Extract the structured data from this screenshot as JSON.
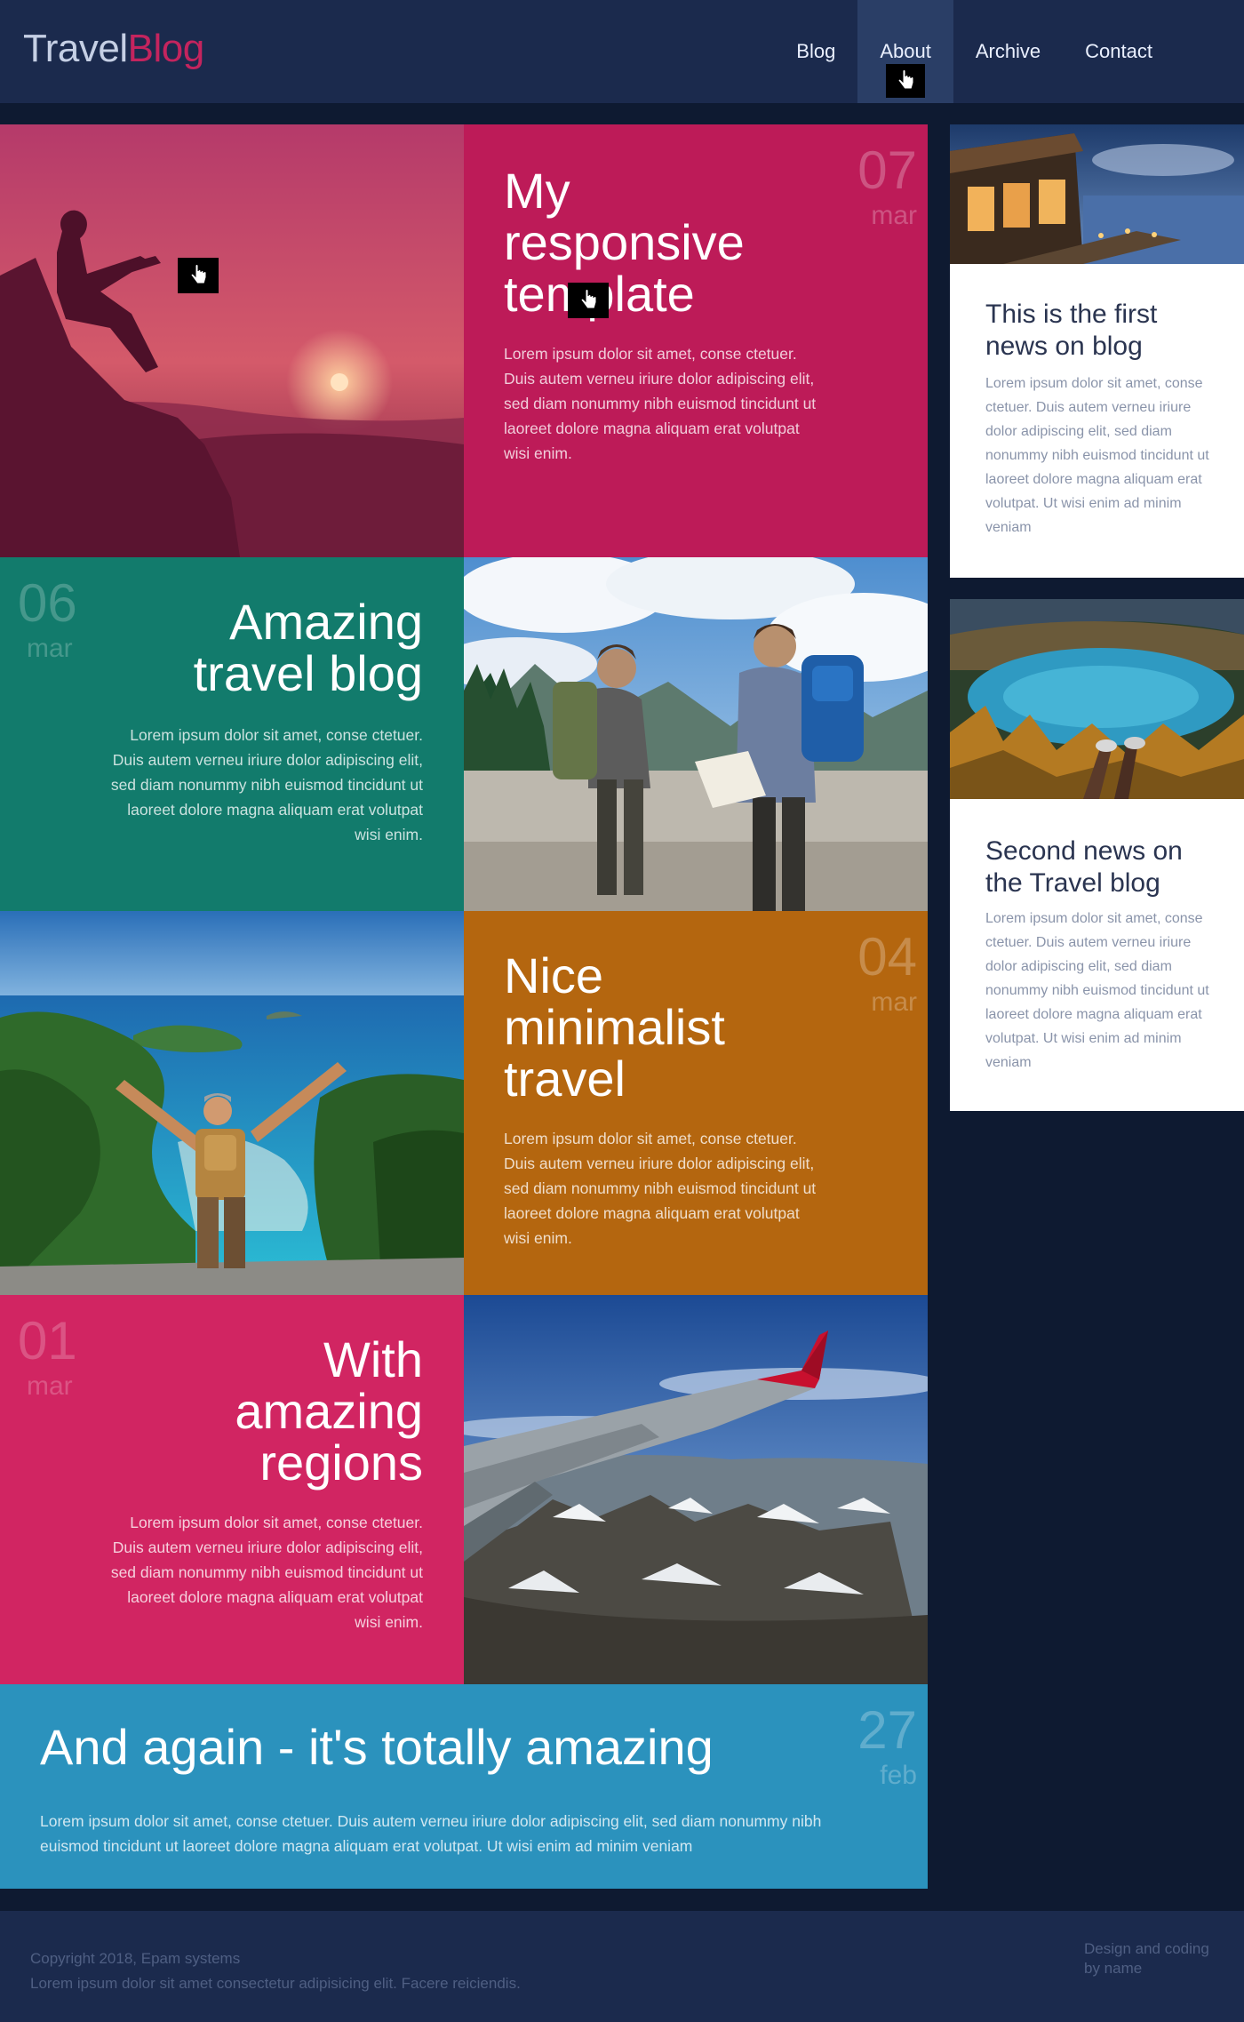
{
  "header": {
    "logo_part1": "Travel",
    "logo_part2": "Blog",
    "nav": [
      "Blog",
      "About",
      "Archive",
      "Contact"
    ]
  },
  "tiles": {
    "t1": {
      "day": "07",
      "month": "mar",
      "title_l1": "My",
      "title_l2": "responsive",
      "title_l3": "template",
      "body": "Lorem ipsum dolor sit amet, conse ctetuer. Duis autem verneu iriure dolor adipiscing elit, sed diam nonummy nibh euismod tincidunt ut laoreet dolore magna aliquam erat volutpat wisi enim."
    },
    "t2": {
      "day": "06",
      "month": "mar",
      "title_l1": "Amazing",
      "title_l2": "travel blog",
      "body": "Lorem ipsum dolor sit amet, conse ctetuer. Duis autem verneu iriure dolor adipiscing elit, sed diam nonummy nibh euismod tincidunt ut laoreet dolore magna aliquam erat volutpat wisi enim."
    },
    "t3": {
      "day": "04",
      "month": "mar",
      "title_l1": "Nice",
      "title_l2": "minimalist",
      "title_l3": "travel",
      "body": "Lorem ipsum dolor sit amet, conse ctetuer. Duis autem verneu iriure dolor adipiscing elit, sed diam nonummy nibh euismod tincidunt ut laoreet dolore magna aliquam erat volutpat wisi enim."
    },
    "t4": {
      "day": "01",
      "month": "mar",
      "title_l1": "With",
      "title_l2": "amazing",
      "title_l3": "regions",
      "body": "Lorem ipsum dolor sit amet, conse ctetuer. Duis autem verneu iriure dolor adipiscing elit, sed diam nonummy nibh euismod tincidunt ut laoreet dolore magna aliquam erat volutpat wisi enim."
    },
    "t5": {
      "day": "27",
      "month": "feb",
      "title": "And again - it's totally amazing",
      "body": "Lorem ipsum dolor sit amet, conse ctetuer. Duis autem verneu iriure dolor adipiscing elit, sed diam nonummy nibh euismod tincidunt ut laoreet dolore magna aliquam erat volutpat. Ut wisi enim ad minim veniam"
    }
  },
  "sidebar": {
    "news1": {
      "title": "This is the first news on blog",
      "body": "Lorem ipsum dolor sit amet, conse ctetuer. Duis autem verneu iriure dolor adipiscing elit, sed diam nonummy nibh euismod tincidunt ut laoreet dolore magna aliquam erat volutpat. Ut wisi enim ad minim veniam"
    },
    "news2": {
      "title": "Second news on the Travel blog",
      "body": "Lorem ipsum dolor sit amet, conse ctetuer. Duis autem verneu iriure dolor adipiscing elit, sed diam nonummy nibh euismod tincidunt ut laoreet dolore magna aliquam erat volutpat. Ut wisi enim ad minim veniam"
    }
  },
  "footer": {
    "copyright": "Copyright 2018, Epam systems",
    "tagline": "Lorem ipsum dolor sit amet consectetur adipisicing elit. Facere reiciendis.",
    "credit": "Design and coding by name"
  },
  "colors": {
    "header_bg": "#1b2a4d",
    "page_bg": "#0e1a31",
    "pink": "#bd1b58",
    "teal": "#127b6c",
    "orange": "#b4660f",
    "rose": "#d12562",
    "blue": "#2b92bd"
  }
}
